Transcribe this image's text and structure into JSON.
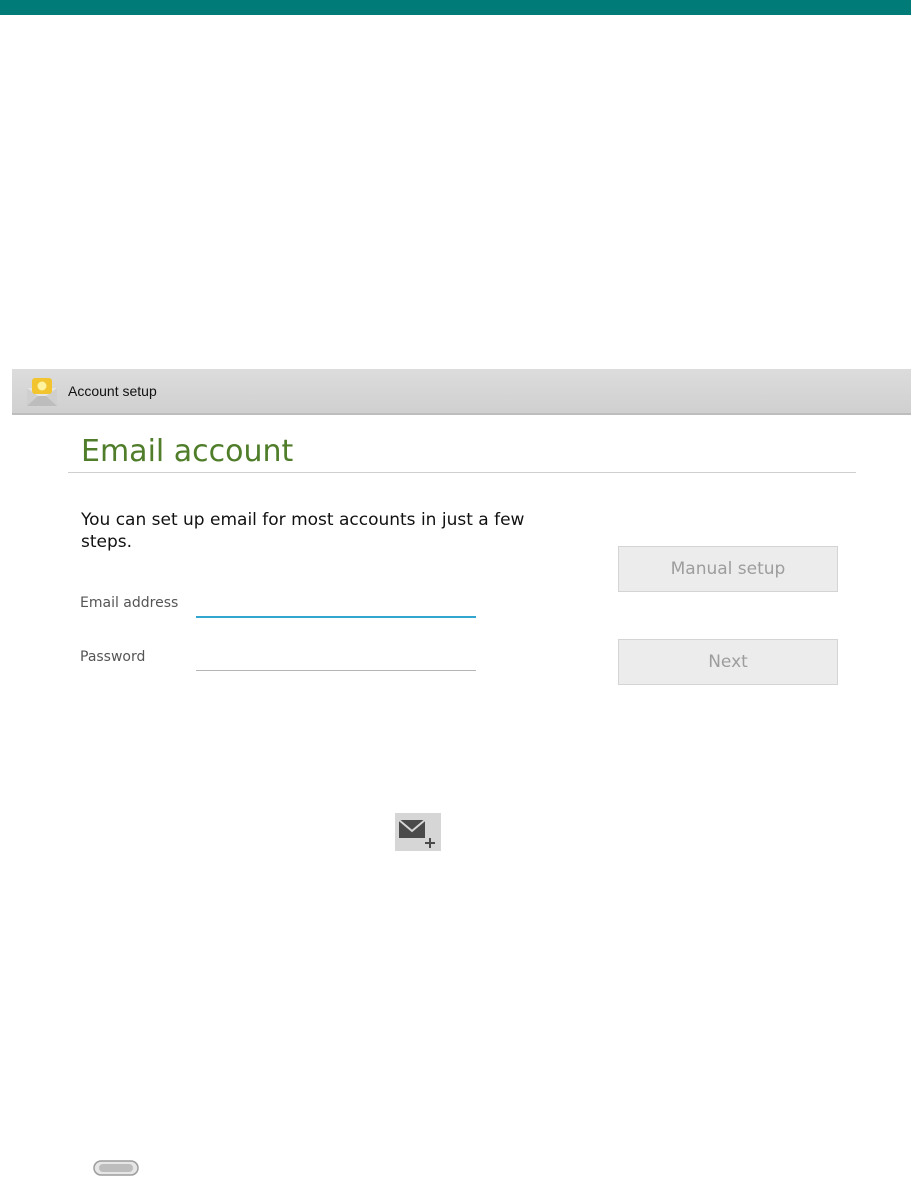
{
  "window": {
    "status_bar_color": "#007b78"
  },
  "action_bar": {
    "title": "Account setup",
    "icon": "email-app-icon"
  },
  "page": {
    "heading": "Email account",
    "heading_color": "#4f7d2a",
    "intro_text": "You can set up email for most accounts in just a few steps."
  },
  "form": {
    "email_label": "Email address",
    "email_value": "",
    "password_label": "Password",
    "password_value": "",
    "focus_color": "#33a6cf"
  },
  "buttons": {
    "manual_setup": "Manual setup",
    "next": "Next"
  },
  "icons": {
    "add_mail": "add-email-icon",
    "nav": "navigation-pill-icon"
  }
}
